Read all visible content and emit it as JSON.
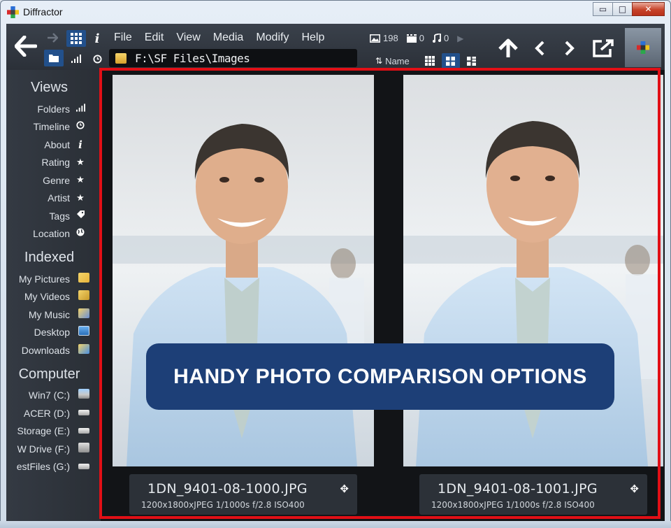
{
  "window": {
    "title": "Diffractor",
    "minimize": "▭",
    "maximize": "□",
    "close": "✕"
  },
  "toolbar": {
    "menu": [
      "File",
      "Edit",
      "View",
      "Media",
      "Modify",
      "Help"
    ],
    "path": "F:\\SF Files\\Images",
    "counts": {
      "images": "198",
      "videos": "0",
      "music": "0"
    },
    "sort_label": "Name",
    "icons": {
      "back": "arrow-left-icon",
      "forward": "arrow-right-icon",
      "grid": "grid-icon",
      "info": "info-icon",
      "folder": "folder-icon",
      "bars": "signal-bars-icon",
      "clock": "clock-icon",
      "up": "arrow-up-icon",
      "prev": "chevron-left-icon",
      "next": "chevron-right-icon",
      "export": "export-icon"
    }
  },
  "sidebar": {
    "views_heading": "Views",
    "views": [
      {
        "label": "Folders",
        "icon": "signal-bars-icon"
      },
      {
        "label": "Timeline",
        "icon": "clock-icon"
      },
      {
        "label": "About",
        "icon": "info-icon"
      },
      {
        "label": "Rating",
        "icon": "star-icon"
      },
      {
        "label": "Genre",
        "icon": "star-icon"
      },
      {
        "label": "Artist",
        "icon": "star-icon"
      },
      {
        "label": "Tags",
        "icon": "tag-icon"
      },
      {
        "label": "Location",
        "icon": "globe-icon"
      }
    ],
    "indexed_heading": "Indexed",
    "indexed": [
      {
        "label": "My Pictures",
        "icon": "pictures-folder-icon"
      },
      {
        "label": "My Videos",
        "icon": "videos-folder-icon"
      },
      {
        "label": "My Music",
        "icon": "music-folder-icon"
      },
      {
        "label": "Desktop",
        "icon": "desktop-icon"
      },
      {
        "label": "Downloads",
        "icon": "downloads-folder-icon"
      }
    ],
    "computer_heading": "Computer",
    "drives": [
      {
        "label": "Win7 (C:)",
        "icon": "system-drive-icon"
      },
      {
        "label": "ACER (D:)",
        "icon": "drive-icon"
      },
      {
        "label": "Storage (E:)",
        "icon": "drive-icon"
      },
      {
        "label": "W Drive (F:)",
        "icon": "usb-drive-icon"
      },
      {
        "label": "estFiles (G:)",
        "icon": "drive-icon"
      }
    ]
  },
  "compare": {
    "left": {
      "filename": "1DN_9401-08-1000.JPG",
      "meta": "1200x1800xJPEG 1/1000s f/2.8 ISO400"
    },
    "right": {
      "filename": "1DN_9401-08-1001.JPG",
      "meta": "1200x1800xJPEG 1/1000s f/2.8 ISO400"
    }
  },
  "banner": {
    "text": "HANDY PHOTO COMPARISON OPTIONS"
  },
  "colors": {
    "highlight": "#e10f16",
    "banner": "#1d3f77",
    "accent": "#22508b"
  }
}
